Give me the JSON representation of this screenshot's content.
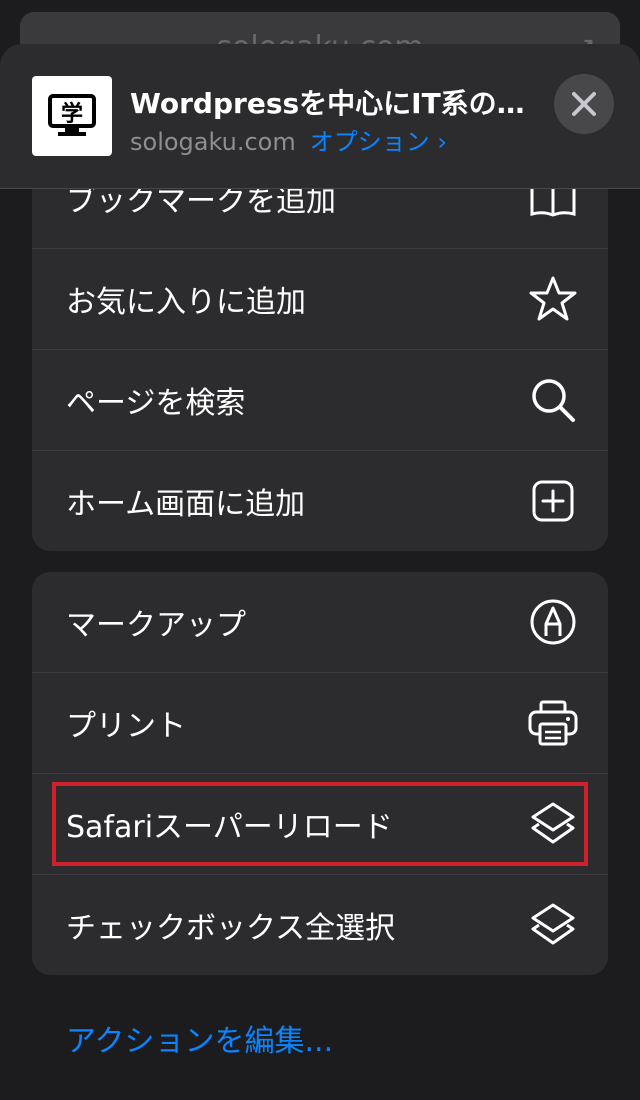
{
  "behind": {
    "url_text": "sologaku.com"
  },
  "header": {
    "title": "Wordpressを中心にIT系の…",
    "domain": "sologaku.com",
    "options_label": "オプション ›",
    "thumb_char": "学",
    "close_icon": "close-icon"
  },
  "group1": {
    "items": [
      {
        "label": "ブックマークを追加",
        "icon": "book-icon"
      },
      {
        "label": "お気に入りに追加",
        "icon": "star-icon"
      },
      {
        "label": "ページを検索",
        "icon": "search-icon"
      },
      {
        "label": "ホーム画面に追加",
        "icon": "plus-square-icon"
      }
    ]
  },
  "group2": {
    "items": [
      {
        "label": "マークアップ",
        "icon": "markup-pen-icon"
      },
      {
        "label": "プリント",
        "icon": "printer-icon"
      },
      {
        "label": "Safariスーパーリロード",
        "icon": "shortcuts-icon",
        "highlighted": true
      },
      {
        "label": "チェックボックス全選択",
        "icon": "shortcuts-icon"
      }
    ]
  },
  "footer": {
    "edit_actions": "アクションを編集..."
  },
  "colors": {
    "background": "#1c1c1e",
    "cell": "#2c2c2e",
    "accent": "#0a84ff",
    "highlight": "#d0212b"
  }
}
